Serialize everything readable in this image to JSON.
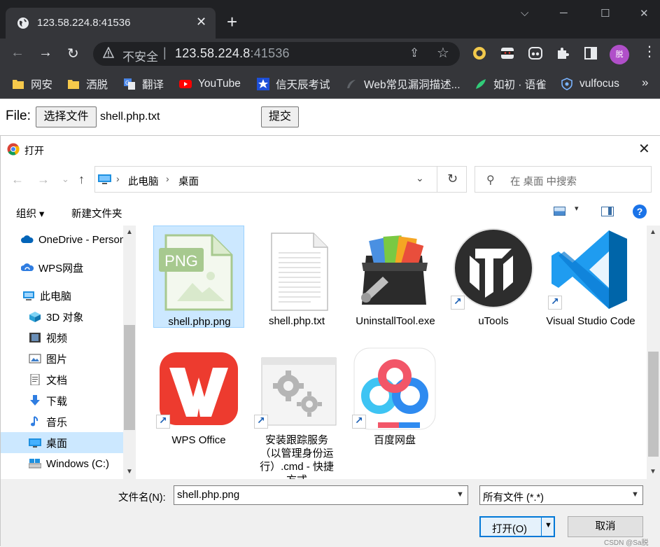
{
  "browser": {
    "tab_title": "123.58.224.8:41536",
    "tab_close": "✕",
    "new_tab": "+",
    "window_controls": {
      "minimize": "─",
      "maximize": "☐",
      "close": "✕",
      "tab_search": "⌵"
    },
    "nav": {
      "back": "←",
      "forward": "→",
      "reload": "↻"
    },
    "security_label": "不安全",
    "separator": "|",
    "url_host": "123.58.224.8",
    "url_port": ":41536",
    "share_icon": "⇪",
    "star_icon": "☆",
    "avatar_text": "脱",
    "more_icon": "»",
    "bookmarks": [
      {
        "label": "网安",
        "icon": "folder-icon"
      },
      {
        "label": "洒脱",
        "icon": "folder-icon"
      },
      {
        "label": "翻译",
        "icon": "translate-icon"
      },
      {
        "label": "YouTube",
        "icon": "youtube-icon"
      },
      {
        "label": "信天辰考试",
        "icon": "star-icon"
      },
      {
        "label": "Web常见漏洞描述...",
        "icon": "web-icon"
      },
      {
        "label": "如初 · 语雀",
        "icon": "yuque-icon"
      },
      {
        "label": "vulfocus",
        "icon": "shield-icon"
      }
    ],
    "colors": {
      "dark": "#202124",
      "toolbar": "#35363a",
      "text": "#e8eaed"
    }
  },
  "page": {
    "file_label": "File:",
    "choose_button": "选择文件",
    "chosen_file": "shell.php.txt",
    "submit_button": "提交"
  },
  "dialog": {
    "title": "打开",
    "close": "✕",
    "nav": {
      "back": "←",
      "forward": "→",
      "recent": "⌄",
      "up": "↑"
    },
    "breadcrumb": [
      "此电脑",
      "桌面"
    ],
    "crumb_sep": "›",
    "address_dropdown": "⌄",
    "refresh": "↻",
    "search_icon": "⚲",
    "search_placeholder": "在 桌面 中搜索",
    "organize": "组织 ▾",
    "new_folder": "新建文件夹",
    "view_dropdown": "▾",
    "help": "?",
    "nav_pane": [
      {
        "label": "OneDrive - Personal",
        "icon": "cloud-icon",
        "selected": false
      },
      {
        "label": "WPS网盘",
        "icon": "wps-cloud-icon",
        "selected": false
      },
      {
        "label": "此电脑",
        "icon": "pc-icon",
        "selected": false
      },
      {
        "label": "3D 对象",
        "icon": "cube-icon",
        "selected": false
      },
      {
        "label": "视频",
        "icon": "video-icon",
        "selected": false
      },
      {
        "label": "图片",
        "icon": "picture-icon",
        "selected": false
      },
      {
        "label": "文档",
        "icon": "document-icon",
        "selected": false
      },
      {
        "label": "下载",
        "icon": "download-icon",
        "selected": false
      },
      {
        "label": "音乐",
        "icon": "music-icon",
        "selected": false
      },
      {
        "label": "桌面",
        "icon": "desktop-icon",
        "selected": true
      },
      {
        "label": "Windows (C:)",
        "icon": "drive-icon",
        "selected": false
      }
    ],
    "files": [
      {
        "name": "shell.php.png",
        "icon": "png-file-icon",
        "selected": true,
        "shortcut": false
      },
      {
        "name": "shell.php.txt",
        "icon": "text-file-icon",
        "selected": false,
        "shortcut": false
      },
      {
        "name": "UninstallTool.exe",
        "icon": "uninstall-tool-icon",
        "selected": false,
        "shortcut": false
      },
      {
        "name": "uTools",
        "icon": "utools-icon",
        "selected": false,
        "shortcut": true
      },
      {
        "name": "Visual Studio Code",
        "icon": "vscode-icon",
        "selected": false,
        "shortcut": true
      },
      {
        "name": "WPS Office",
        "icon": "wps-icon",
        "selected": false,
        "shortcut": true
      },
      {
        "name": "安装跟踪服务（以管理身份运行）.cmd - 快捷方式",
        "icon": "cmd-gears-icon",
        "selected": false,
        "shortcut": true
      },
      {
        "name": "百度网盘",
        "icon": "baidu-netdisk-icon",
        "selected": false,
        "shortcut": true
      }
    ],
    "filename_label": "文件名(N):",
    "filename_value": "shell.php.png",
    "filter_value": "所有文件 (*.*)",
    "open_button": "打开(O)",
    "cancel_button": "取消",
    "watermark": "CSDN @Sa脱"
  }
}
